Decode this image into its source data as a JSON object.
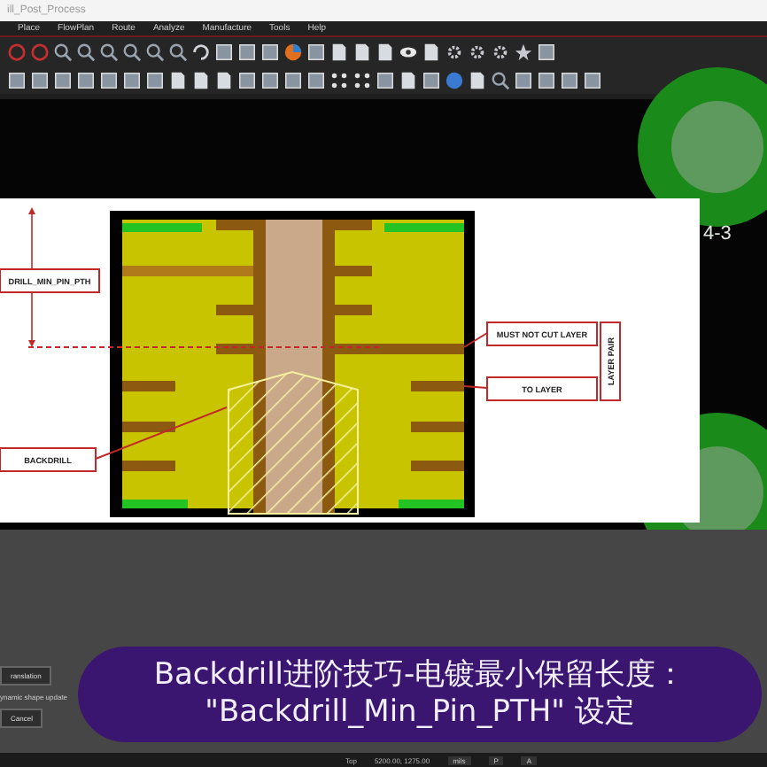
{
  "window": {
    "title": "ill_Post_Process"
  },
  "menu": [
    "Place",
    "FlowPlan",
    "Route",
    "Analyze",
    "Manufacture",
    "Tools",
    "Help"
  ],
  "canvas": {
    "pad_label": "4-3"
  },
  "diagram": {
    "callouts": [
      {
        "kind": "drill",
        "text": "DRILL_MIN_PIN_PTH"
      },
      {
        "kind": "backdrill",
        "text": "BACKDRILL"
      },
      {
        "kind": "must_not_cut",
        "text": "MUST NOT CUT LAYER"
      },
      {
        "kind": "to_layer",
        "text": "TO LAYER"
      }
    ],
    "bracket_label": "LAYER PAIR"
  },
  "dialog": {
    "buttons": [
      "ranslation",
      "Cancel"
    ],
    "option": "ynamic shape update"
  },
  "subtitle": {
    "lines": [
      "Backdrill进阶技巧-电镀最小保留长度：",
      "\"Backdrill_Min_Pin_PTH\" 设定"
    ]
  },
  "status_bar": {
    "layer": "Top",
    "coords": "5200.00, 1275.00",
    "units": "mils",
    "buttons": [
      "P",
      "A"
    ]
  }
}
